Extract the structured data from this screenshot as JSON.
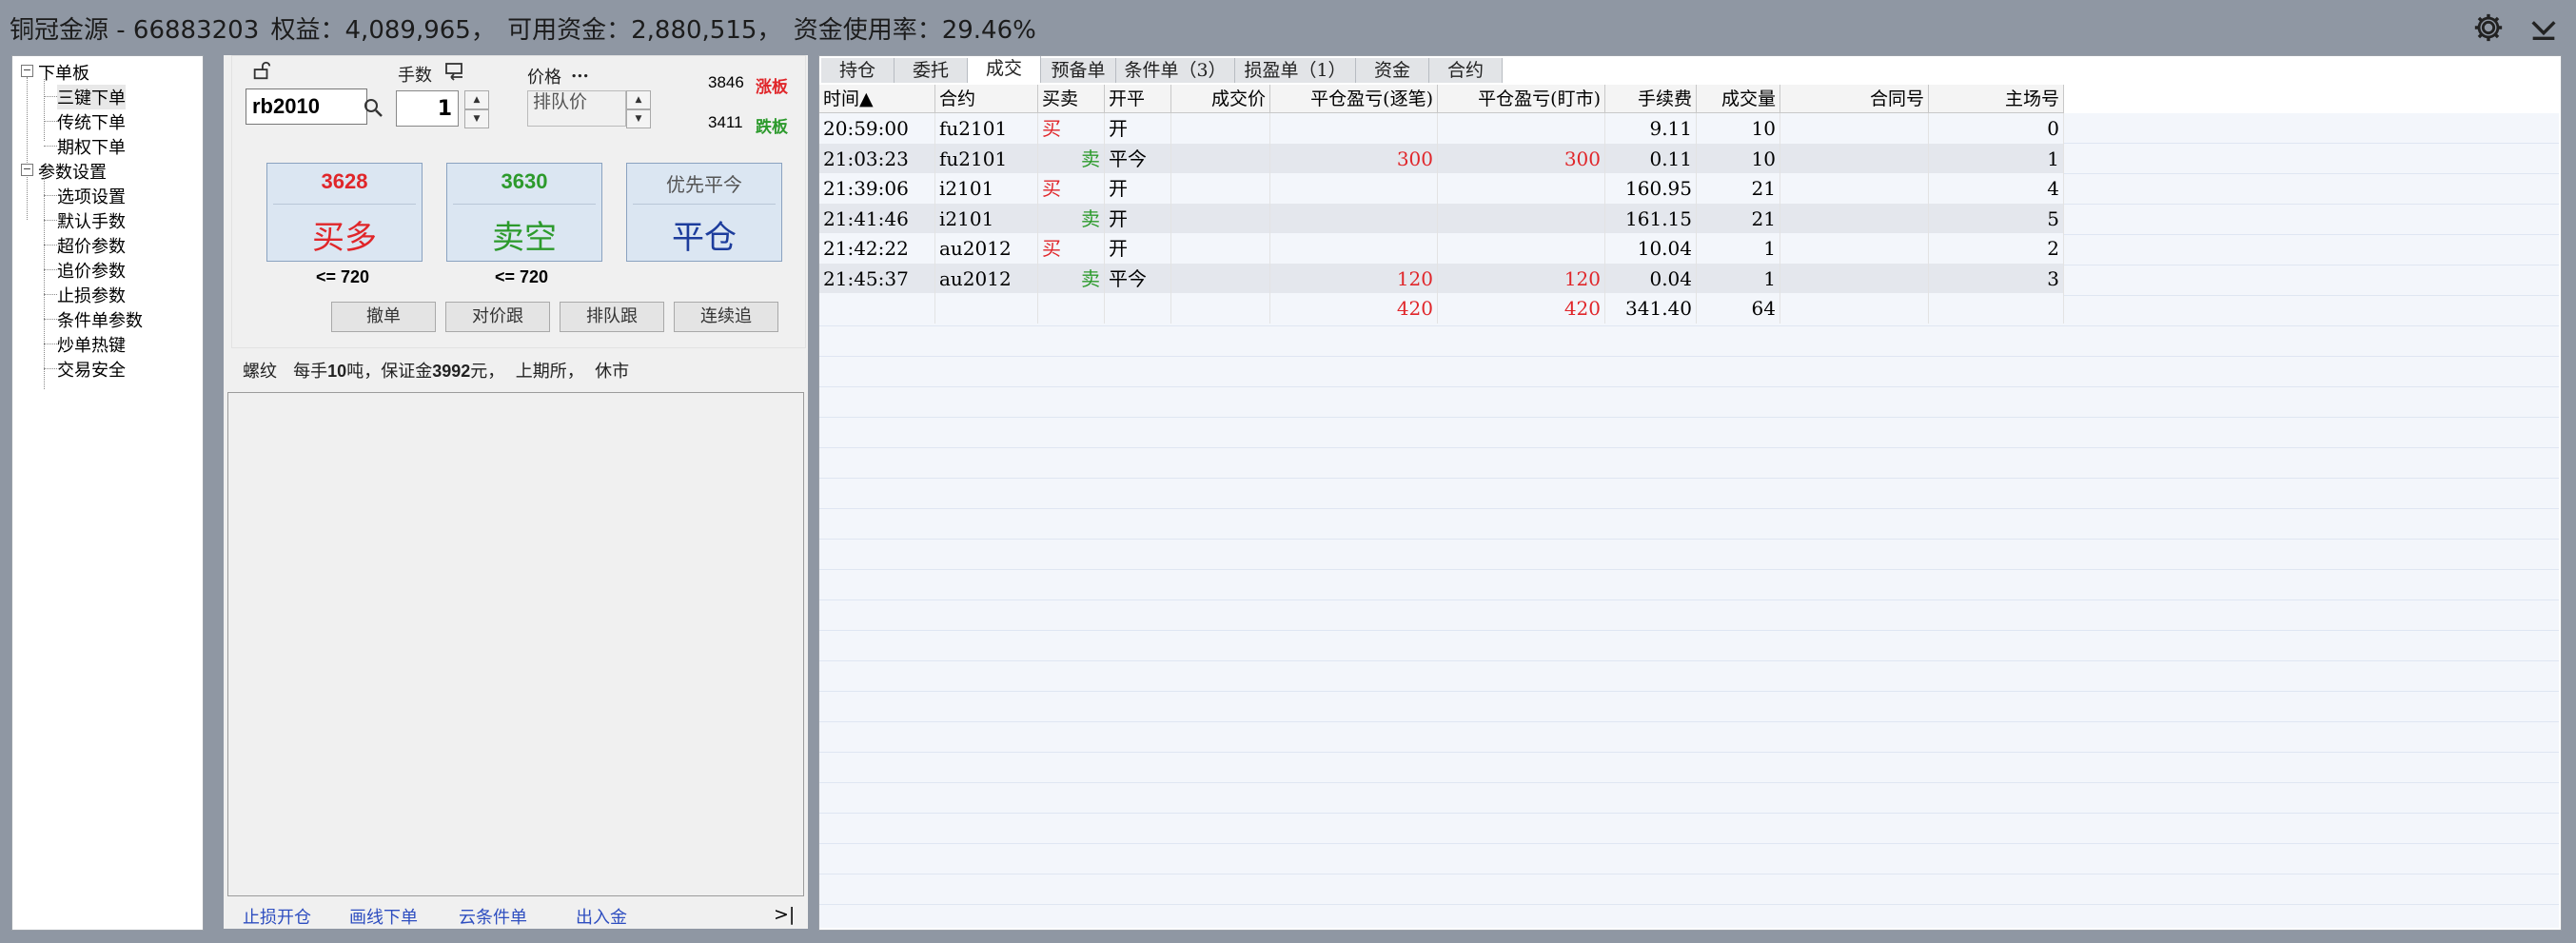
{
  "title": {
    "account": "铜冠金源 - 66883203",
    "equity": "权益：4,089,965，",
    "available": "可用资金：2,880,515，",
    "usage": "资金使用率：29.46%"
  },
  "toolbar": {
    "settings_icon": "gear-icon",
    "collapse_icon": "chevron-down-icon"
  },
  "tree": {
    "groups": [
      {
        "label": "下单板",
        "children": [
          "三键下单",
          "传统下单",
          "期权下单"
        ]
      },
      {
        "label": "参数设置",
        "children": [
          "选项设置",
          "默认手数",
          "超价参数",
          "追价参数",
          "止损参数",
          "条件单参数",
          "炒单热键",
          "交易安全"
        ]
      }
    ]
  },
  "order": {
    "symbol": "rb2010",
    "lots_label": "手数",
    "lots": "1",
    "price_label": "价格",
    "price_more": "...",
    "price_placeholder": "排队价",
    "limit_up_value": "3846",
    "limit_up_label": "涨板",
    "limit_down_value": "3411",
    "limit_down_label": "跌板",
    "buy_price": "3628",
    "buy_label": "买多",
    "sell_price": "3630",
    "sell_label": "卖空",
    "close_top": "优先平今",
    "close_label": "平仓",
    "buy_limit": "<= 720",
    "sell_limit": "<= 720",
    "actions": [
      "撤单",
      "对价跟",
      "排队跟",
      "连续追"
    ],
    "info": {
      "name": "螺纹",
      "unit_prefix": "每手",
      "unit_value": "10",
      "unit_suffix": "吨，保证金",
      "margin": "3992",
      "margin_suffix": "元，",
      "exchange": "上期所，",
      "status": "休市"
    },
    "bottom_links": [
      "止损开仓",
      "画线下单",
      "云条件单",
      "出入金"
    ]
  },
  "tabs": [
    "持仓",
    "委托",
    "成交",
    "预备单",
    "条件单（3）",
    "损盈单（1）",
    "资金",
    "合约"
  ],
  "active_tab": "成交",
  "table": {
    "headers": [
      "时间▲",
      "合约",
      "买卖",
      "开平",
      "成交价",
      "平仓盈亏(逐笔)",
      "平仓盈亏(盯市)",
      "手续费",
      "成交量",
      "合同号",
      "主场号"
    ],
    "rows": [
      [
        "20:59:00",
        "fu2101",
        "买",
        "开",
        "",
        "",
        "",
        "9.11",
        "10",
        "",
        "0"
      ],
      [
        "21:03:23",
        "fu2101",
        "卖",
        "平今",
        "",
        "300",
        "300",
        "0.11",
        "10",
        "",
        "1"
      ],
      [
        "21:39:06",
        "i2101",
        "买",
        "开",
        "",
        "",
        "",
        "160.95",
        "21",
        "",
        "4"
      ],
      [
        "21:41:46",
        "i2101",
        "卖",
        "开",
        "",
        "",
        "",
        "161.15",
        "21",
        "",
        "5"
      ],
      [
        "21:42:22",
        "au2012",
        "买",
        "开",
        "",
        "",
        "",
        "10.04",
        "1",
        "",
        "2"
      ],
      [
        "21:45:37",
        "au2012",
        "卖",
        "平今",
        "",
        "120",
        "120",
        "0.04",
        "1",
        "",
        "3"
      ]
    ],
    "totals": [
      "",
      "",
      "",
      "",
      "",
      "420",
      "420",
      "341.40",
      "64",
      "",
      ""
    ]
  },
  "colors": {
    "buy": "#e0262a",
    "sell": "#2c9a2c",
    "link": "#2e4ec0"
  }
}
